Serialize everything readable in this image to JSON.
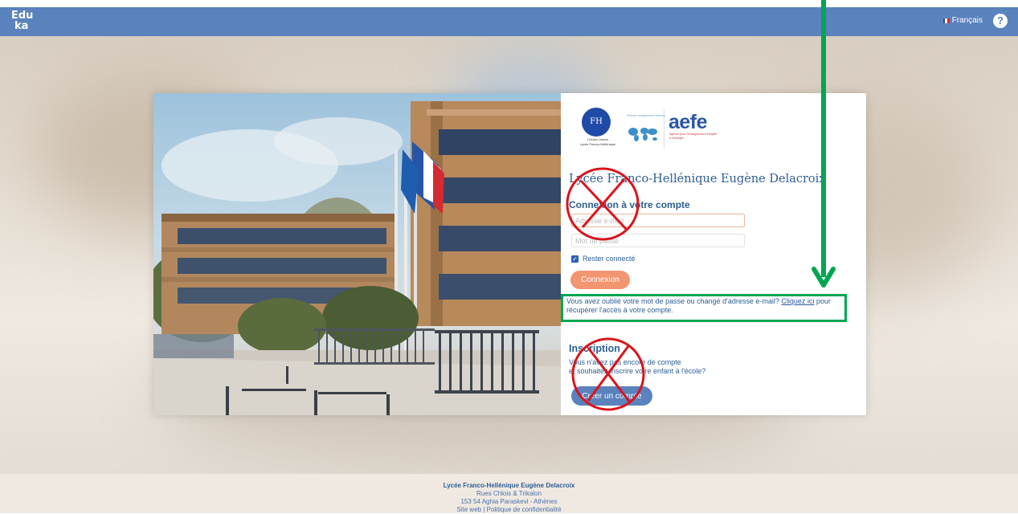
{
  "topbar": {
    "logo_line1": "Edu",
    "logo_line2": "ka",
    "language": "Français",
    "help_glyph": "?",
    "background_color": "#5a82bd"
  },
  "brand": {
    "lfh_monogram": "FH",
    "lfh_caption_greek": "Γαλλικό Λύκειο",
    "lfh_caption_fr": "Lycée Franco-Hellénique",
    "agency_tag": "Réseau enseignement français",
    "aefe_wordmark": "aefe",
    "aefe_subtitle": "Agence pour l'enseignement français à l'étranger"
  },
  "school": {
    "title": "Lycée Franco-Hellénique Eugène Delacroix"
  },
  "login": {
    "heading": "Connexion à votre compte",
    "email_placeholder": "Adresse e-mail",
    "password_placeholder": "Mot de passe",
    "remember_label": "Rester connecté",
    "remember_checked": true,
    "submit_label": "Connexion",
    "submit_color": "#f19670"
  },
  "forgot": {
    "text_before": "Vous avez oublié votre mot de passe ou changé d'adresse e-mail? ",
    "link_label": "Cliquez ici",
    "text_after": " pour récupérer l'accès à votre compte."
  },
  "inscription": {
    "heading": "Inscription",
    "text_line1": "Vous n'avez pas encore de compte",
    "text_line2": "et souhaitez inscrire votre enfant à l'école?",
    "button_label": "Créer un compte"
  },
  "footer": {
    "name": "Lycée Franco-Hellénique Eugène Delacroix",
    "address_line1": "Rues Chlois & Trikalon",
    "address_line2": "153 54 Aghia Paraskevi - Athènes",
    "links": "Site web | Politique de confidentialité"
  },
  "annotation_colors": {
    "highlight": "#00a651",
    "cross": "#d9141b"
  }
}
